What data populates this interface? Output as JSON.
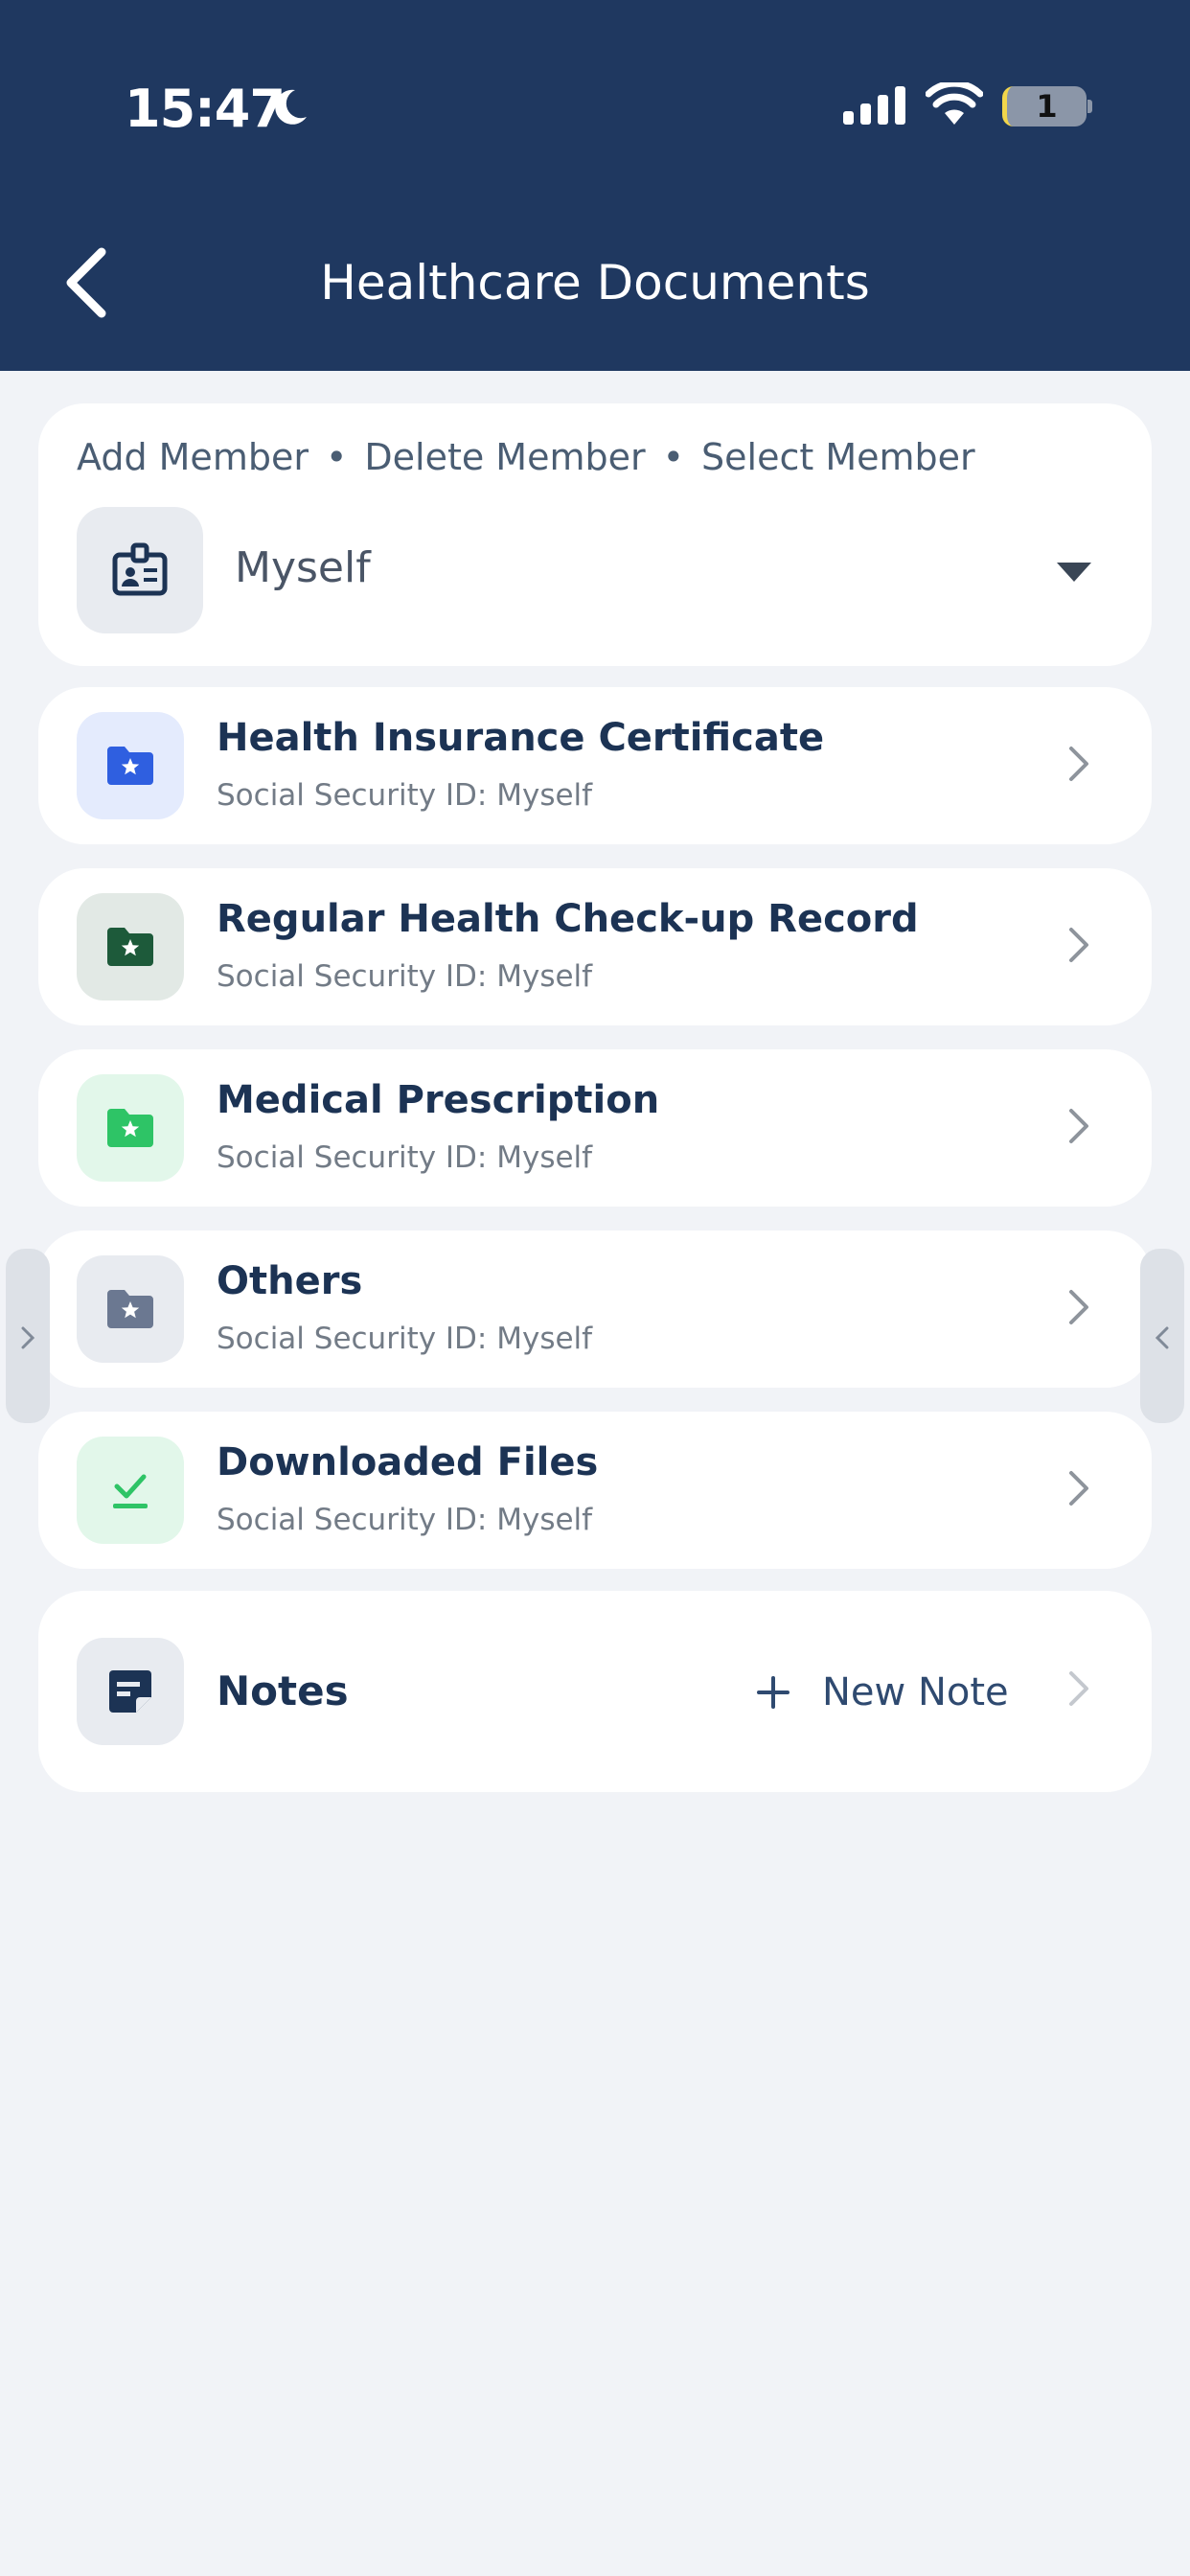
{
  "status_bar": {
    "time": "15:47",
    "battery_level": "1"
  },
  "nav": {
    "title": "Healthcare Documents"
  },
  "member": {
    "actions": [
      "Add Member",
      "Delete Member",
      "Select Member"
    ],
    "separator": "•",
    "selected": "Myself"
  },
  "documents": [
    {
      "title": "Health Insurance Certificate",
      "subtitle": "Social Security ID: Myself",
      "icon": "folder-star-icon",
      "color": "#2f5fe0",
      "bg": "#e4ebfd"
    },
    {
      "title": "Regular Health Check-up Record",
      "subtitle": "Social Security ID: Myself",
      "icon": "folder-star-icon",
      "color": "#1d5a3a",
      "bg": "#e2e9e5"
    },
    {
      "title": "Medical Prescription",
      "subtitle": "Social Security ID: Myself",
      "icon": "folder-star-icon",
      "color": "#2ec466",
      "bg": "#e2f7ea"
    },
    {
      "title": "Others",
      "subtitle": "Social Security ID: Myself",
      "icon": "folder-star-icon",
      "color": "#6b7891",
      "bg": "#e8ebf0"
    },
    {
      "title": "Downloaded Files",
      "subtitle": "Social Security ID: Myself",
      "icon": "download-check-icon",
      "color": "#2ec466",
      "bg": "#e2f7ea"
    }
  ],
  "notes": {
    "label": "Notes",
    "new_note_label": "New Note"
  },
  "colors": {
    "header": "#1f3860",
    "background": "#f1f3f7",
    "text_primary": "#1c3354"
  }
}
